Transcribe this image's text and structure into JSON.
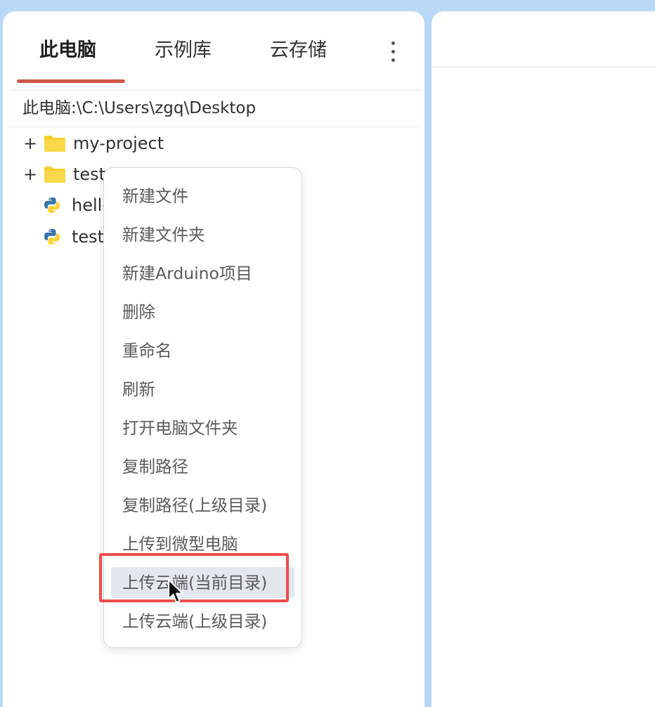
{
  "tabs": [
    {
      "label": "此电脑",
      "active": true
    },
    {
      "label": "示例库",
      "active": false
    },
    {
      "label": "云存储",
      "active": false
    }
  ],
  "more_icon": "vertical-ellipsis-icon",
  "path": "此电脑:\\C:\\Users\\zgq\\Desktop",
  "tree": [
    {
      "expander": "+",
      "icon": "folder-icon",
      "label": "my-project"
    },
    {
      "expander": "+",
      "icon": "folder-icon",
      "label": "test"
    },
    {
      "expander": "",
      "icon": "python-file-icon",
      "label": "hello"
    },
    {
      "expander": "",
      "icon": "python-file-icon",
      "label": "test"
    }
  ],
  "context_menu": {
    "items": [
      "新建文件",
      "新建文件夹",
      "新建Arduino项目",
      "删除",
      "重命名",
      "刷新",
      "打开电脑文件夹",
      "复制路径",
      "复制路径(上级目录)",
      "上传到微型电脑",
      "上传云端(当前目录)",
      "上传云端(上级目录)"
    ],
    "hovered_index": 10
  },
  "colors": {
    "accent": "#cf5647",
    "highlight_border": "#ef4b4b",
    "folder": "#f7cf2d",
    "python_blue": "#3776ab",
    "python_yellow": "#ffd43b",
    "background": "#b9d8f6"
  }
}
